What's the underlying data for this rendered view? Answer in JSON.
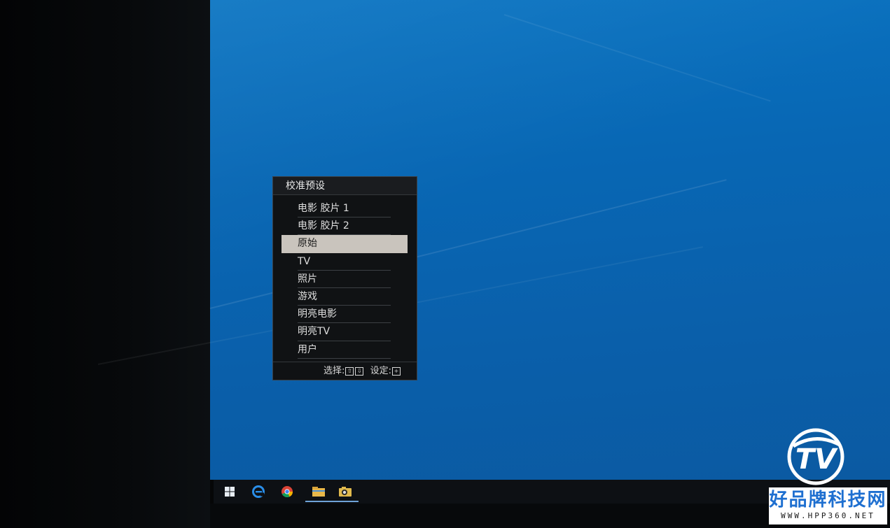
{
  "osd": {
    "title": "校准预设",
    "items": [
      {
        "label": "电影 胶片 1"
      },
      {
        "label": "电影 胶片 2"
      },
      {
        "label": "原始",
        "selected": true
      },
      {
        "label": "TV"
      },
      {
        "label": "照片"
      },
      {
        "label": "游戏"
      },
      {
        "label": "明亮电影"
      },
      {
        "label": "明亮TV"
      },
      {
        "label": "用户"
      }
    ],
    "footer": {
      "select_label": "选择:",
      "select_keys": [
        "⇧",
        "⇩"
      ],
      "set_label": "设定:",
      "set_key": "+"
    }
  },
  "taskbar": {
    "items": [
      {
        "icon": "windows-start-icon",
        "active": false
      },
      {
        "icon": "edge-icon",
        "active": false
      },
      {
        "icon": "chrome-icon",
        "active": false
      },
      {
        "icon": "file-explorer-icon",
        "active": true
      },
      {
        "icon": "camera-app-icon",
        "active": true
      }
    ]
  },
  "watermark": {
    "logo_letters": "TV",
    "name": "好品牌科技网",
    "url": "WWW.HPP360.NET"
  },
  "colors": {
    "desktop_blue": "#0a6bb8",
    "osd_bg": "#101214",
    "osd_selected": "#c9c4bd",
    "watermark_blue": "#1e6fd0"
  }
}
